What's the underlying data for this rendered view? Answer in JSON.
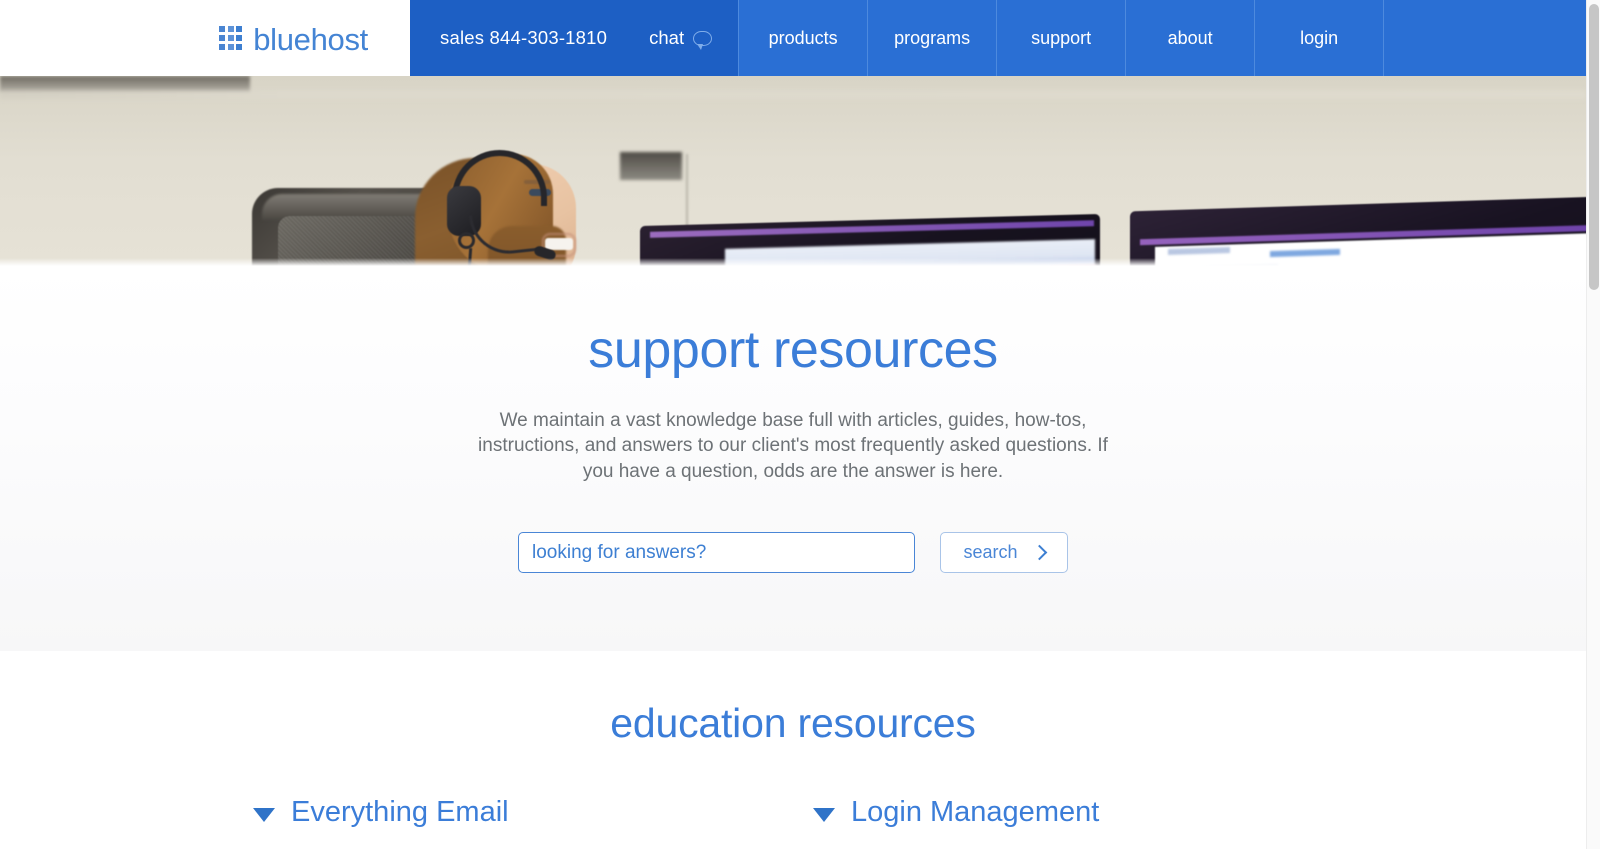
{
  "brand": {
    "name": "bluehost",
    "logo_icon": "grid-squares-icon",
    "logo_color": "#4484d4"
  },
  "topnav": {
    "background_color": "#2a6fd4",
    "sales": {
      "phone_label": "sales 844-303-1810",
      "chat_label": "chat",
      "chat_icon": "speech-bubble-icon"
    },
    "items": [
      {
        "label": "products"
      },
      {
        "label": "programs"
      },
      {
        "label": "support"
      },
      {
        "label": "about"
      },
      {
        "label": "login"
      }
    ]
  },
  "hero": {
    "alt": "support agent with headset at desk with monitors"
  },
  "support": {
    "title": "support resources",
    "subtitle": "We maintain a vast knowledge base full with articles, guides, how-tos, instructions, and answers to our client's most frequently asked questions. If you have a question, odds are the answer is here.",
    "search": {
      "placeholder": "looking for answers?",
      "value": "",
      "button_label": "search",
      "button_icon": "chevron-right-icon"
    },
    "accent_color": "#3b7dd8"
  },
  "education": {
    "title": "education resources",
    "accordions": [
      {
        "label": "Everything Email",
        "icon": "triangle-down-icon",
        "expanded": false
      },
      {
        "label": "Login Management",
        "icon": "triangle-down-icon",
        "expanded": false
      }
    ]
  },
  "scrollbar": {
    "orientation": "vertical",
    "position": "right"
  }
}
